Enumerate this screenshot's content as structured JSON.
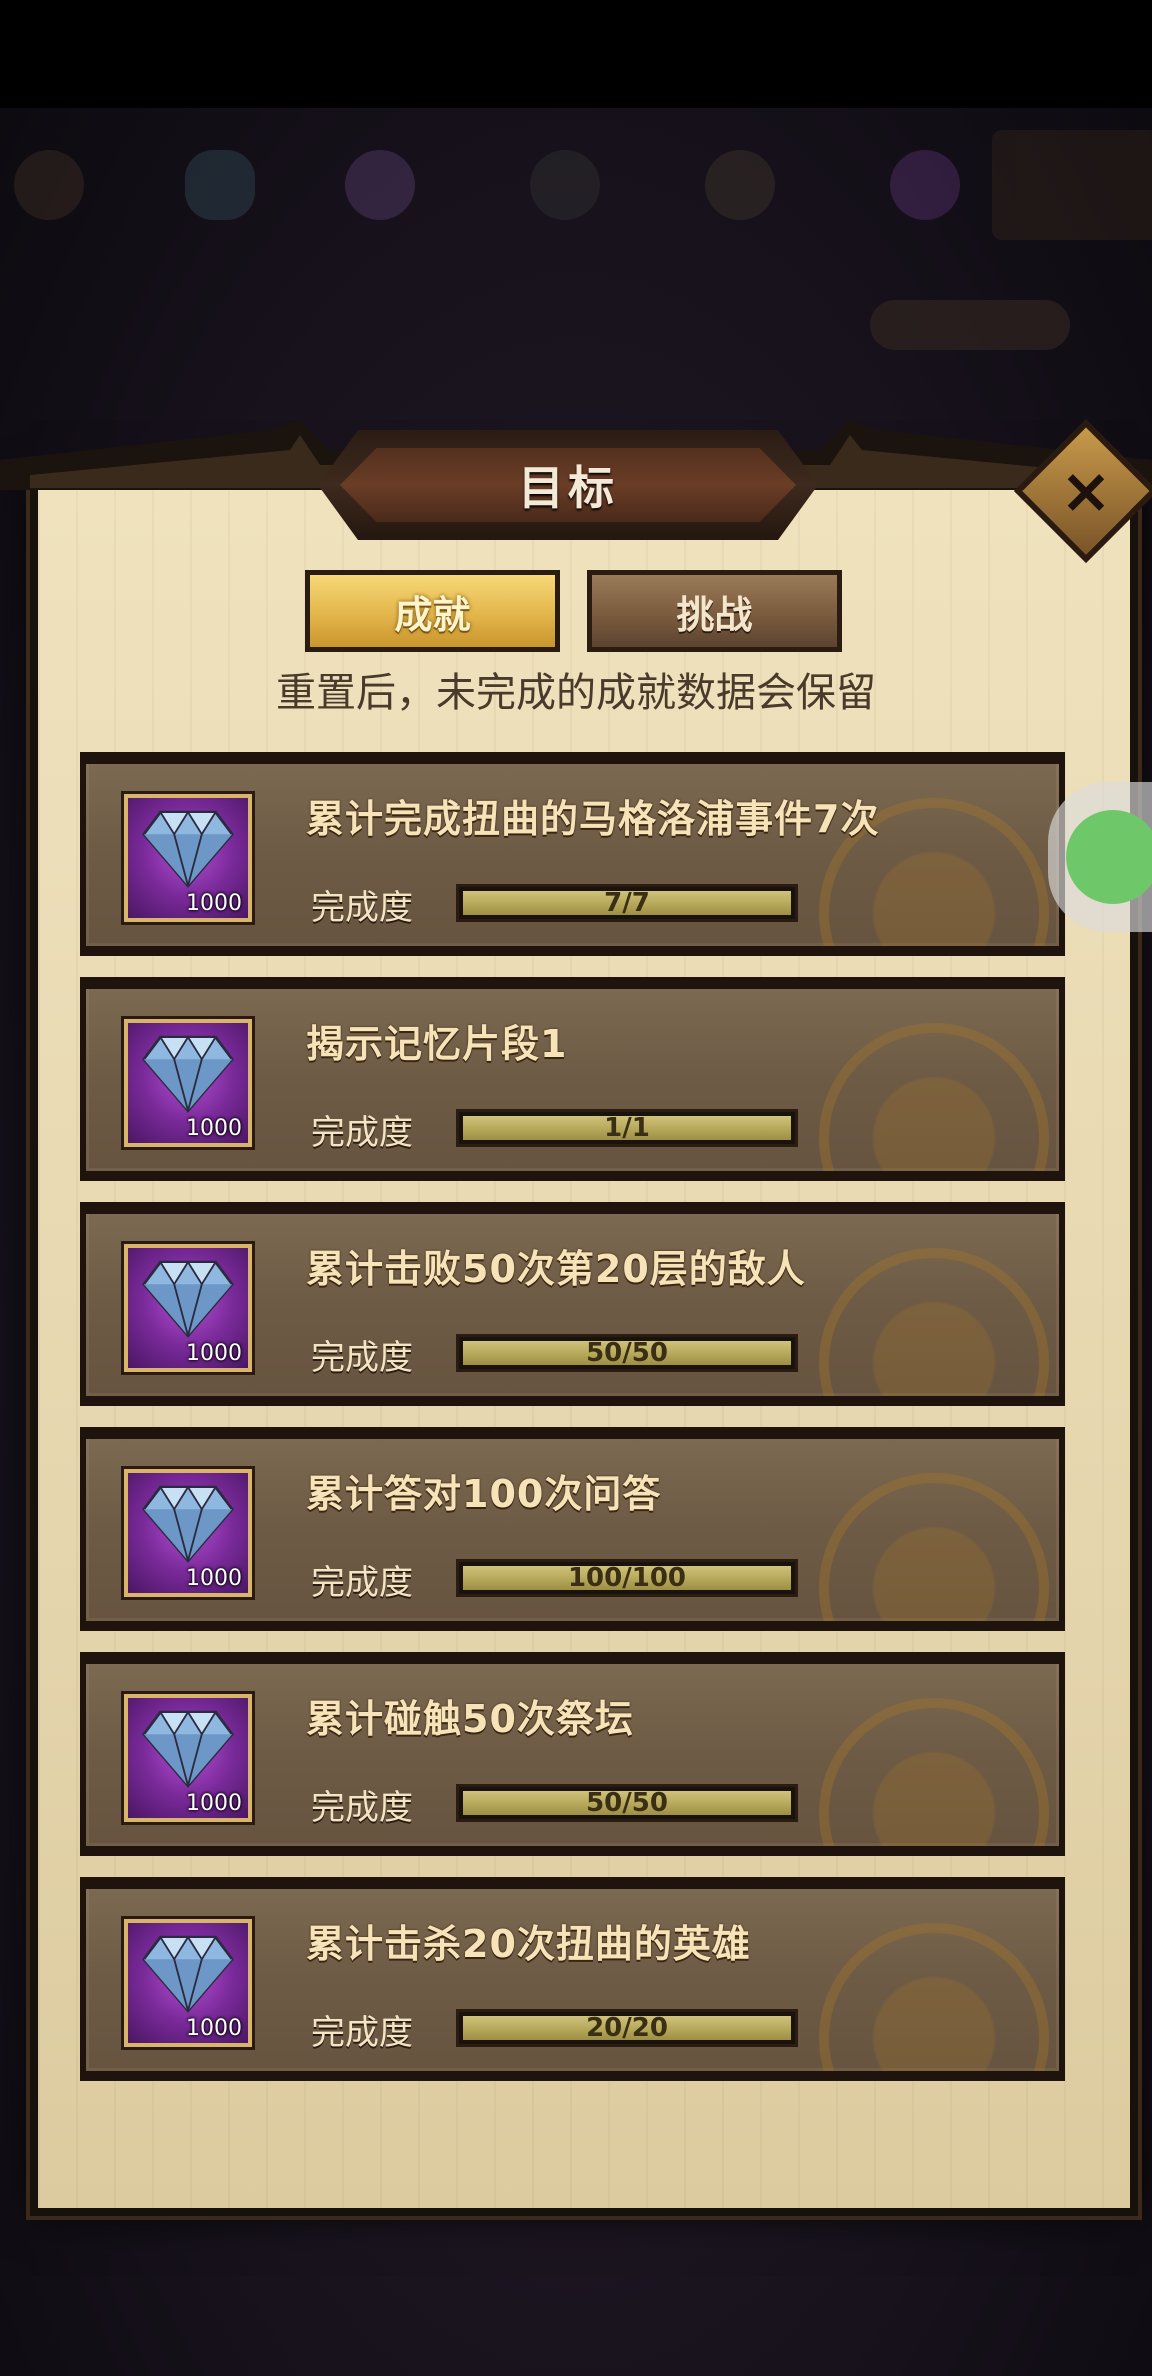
{
  "dialog": {
    "title": "目标",
    "tabs": [
      {
        "label": "成就",
        "active": true
      },
      {
        "label": "挑战",
        "active": false
      }
    ],
    "subtitle": "重置后，未完成的成就数据会保留",
    "close_icon": "close-x-icon",
    "progress_label": "完成度",
    "achievements": [
      {
        "title": "累计完成扭曲的马格洛浦事件7次",
        "reward_icon": "diamond-icon",
        "reward_qty": "1000",
        "progress": "7/7",
        "fill": 1.0
      },
      {
        "title": "揭示记忆片段1",
        "reward_icon": "diamond-icon",
        "reward_qty": "1000",
        "progress": "1/1",
        "fill": 1.0
      },
      {
        "title": "累计击败50次第20层的敌人",
        "reward_icon": "diamond-icon",
        "reward_qty": "1000",
        "progress": "50/50",
        "fill": 1.0
      },
      {
        "title": "累计答对100次问答",
        "reward_icon": "diamond-icon",
        "reward_qty": "1000",
        "progress": "100/100",
        "fill": 1.0
      },
      {
        "title": "累计碰触50次祭坛",
        "reward_icon": "diamond-icon",
        "reward_qty": "1000",
        "progress": "50/50",
        "fill": 1.0
      },
      {
        "title": "累计击杀20次扭曲的英雄",
        "reward_icon": "diamond-icon",
        "reward_qty": "1000",
        "progress": "20/20",
        "fill": 1.0
      }
    ]
  },
  "colors": {
    "parchment": "#e9dbb6",
    "card": "#6e5b45",
    "tab_active": "#e3b64b",
    "tab_inactive": "#7a5c3e",
    "reward_bg": "#7a2a9a"
  }
}
